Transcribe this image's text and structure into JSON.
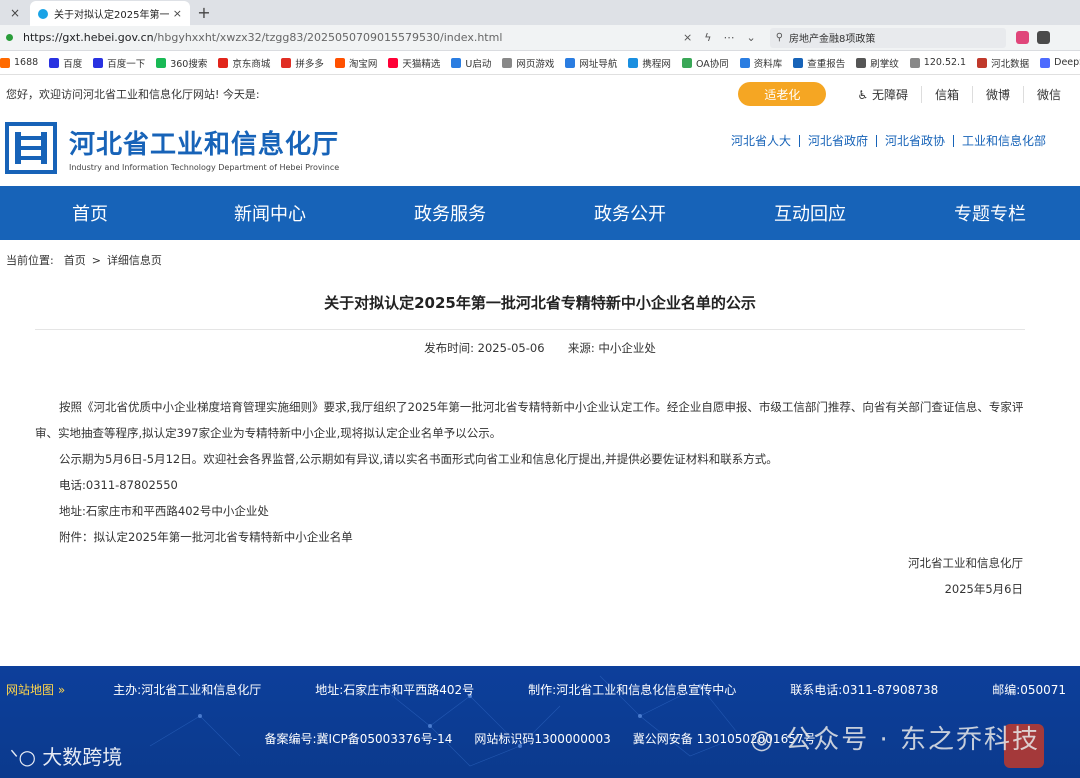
{
  "browser": {
    "prev_tab_close": "×",
    "tab_title": "关于对拟认定2025年第一批河",
    "tab_close": "×",
    "new_tab": "+",
    "url_host": "https://gxt.hebei.gov.cn",
    "url_path": "/hbgyhxxht/xwzx32/tzgg83/20250507090155795​30/index.html",
    "search_text": "房地产金融8项政策",
    "bookmarks": [
      {
        "label": "1688",
        "color": "#ff6a00"
      },
      {
        "label": "百度",
        "color": "#2932e1"
      },
      {
        "label": "百度一下",
        "color": "#2932e1"
      },
      {
        "label": "360搜索",
        "color": "#19b955"
      },
      {
        "label": "京东商城",
        "color": "#e1251b"
      },
      {
        "label": "拼多多",
        "color": "#e02e24"
      },
      {
        "label": "淘宝网",
        "color": "#ff5000"
      },
      {
        "label": "天猫精选",
        "color": "#ff0036"
      },
      {
        "label": "U启动",
        "color": "#2a7de1"
      },
      {
        "label": "网页游戏",
        "color": "#888888"
      },
      {
        "label": "网址导航",
        "color": "#2a7de1"
      },
      {
        "label": "携程网",
        "color": "#1a8fe0"
      },
      {
        "label": "OA协同",
        "color": "#3aa757"
      },
      {
        "label": "资料库",
        "color": "#2a7de1"
      },
      {
        "label": "查重报告",
        "color": "#1763b8"
      },
      {
        "label": "刷掌纹",
        "color": "#555555"
      },
      {
        "label": "120.52.1",
        "color": "#888888"
      },
      {
        "label": "河北数据",
        "color": "#c0392b"
      },
      {
        "label": "DeepSe",
        "color": "#4d6bfe"
      }
    ]
  },
  "site": {
    "welcome": "您好，欢迎访问河北省工业和信息化厅网站! 今天是:",
    "elder_mode": "适老化",
    "top_links": [
      "无障碍",
      "信箱",
      "微博",
      "微信"
    ],
    "logo_cn": "河北省工业和信息化厅",
    "logo_en": "Industry and Information Technology Department of Hebei Province",
    "partner_links": [
      "河北省人大",
      "河北省政府",
      "河北省政协",
      "工业和信息化部"
    ],
    "nav": [
      "首页",
      "新闻中心",
      "政务服务",
      "政务公开",
      "互动回应",
      "专题专栏"
    ],
    "brand_color": "#1763b8"
  },
  "breadcrumb": {
    "label": "当前位置:",
    "home": "首页",
    "sep": ">",
    "current": "详细信息页"
  },
  "article": {
    "title": "关于对拟认定2025年第一批河北省专精特新中小企业名单的公示",
    "publish_label": "发布时间:",
    "publish_date": "2025-05-06",
    "source_label": "来源:",
    "source": "中小企业处",
    "paragraphs": [
      "按照《河北省优质中小企业梯度培育管理实施细则》要求,我厅组织了2025年第一批河北省专精特新中小企业认定工作。经企业自愿申报、市级工信部门推荐、向省有关部门查证信息、专家评审、实地抽查等程序,拟认定397家企业为专精特新中小企业,现将拟认定企业名单予以公示。",
      "公示期为5月6日-5月12日。欢迎社会各界监督,公示期如有异议,请以实名书面形式向省工业和信息化厅提出,并提供必要佐证材料和联系方式。",
      "电话:0311-87802550",
      "地址:石家庄市和平西路402号中小企业处",
      "附件：拟认定2025年第一批河北省专精特新中小企业名单"
    ],
    "signature": "河北省工业和信息化厅",
    "signature_date": "2025年5月6日"
  },
  "footer": {
    "sitemap": "网站地图 »",
    "sponsor": "主办:河北省工业和信息化厅",
    "address": "地址:石家庄市和平西路402号",
    "producer": "制作:河北省工业和信息化信息宣传中心",
    "phone": "联系电话:0311-87908738",
    "postcode": "邮编:050071",
    "icp": "备案编号:冀ICP备05003376号-14",
    "site_id": "网站标识码1300000003",
    "police": "冀公网安备 13010502001657号"
  },
  "watermarks": {
    "left": "大数跨境",
    "right": "公众号 · 东之乔科技"
  }
}
